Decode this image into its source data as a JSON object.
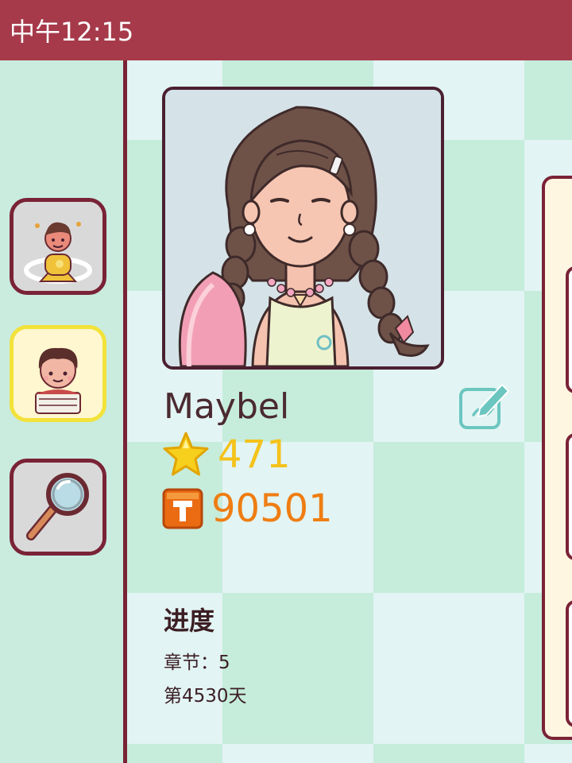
{
  "status_bar": {
    "time": "中午12:15"
  },
  "sidebar": {
    "items": [
      {
        "name": "character-switch",
        "active": false
      },
      {
        "name": "profile",
        "active": true
      },
      {
        "name": "search",
        "active": false
      }
    ]
  },
  "profile": {
    "name": "Maybel",
    "stars": "471",
    "coins": "90501"
  },
  "progress": {
    "title": "进度",
    "chapter": "章节：5",
    "day": "第4530天"
  },
  "colors": {
    "header": "#a63a4a",
    "border": "#7a2336",
    "star": "#f4c21a",
    "coin": "#ef7d12",
    "active_highlight": "#f2e23a"
  }
}
